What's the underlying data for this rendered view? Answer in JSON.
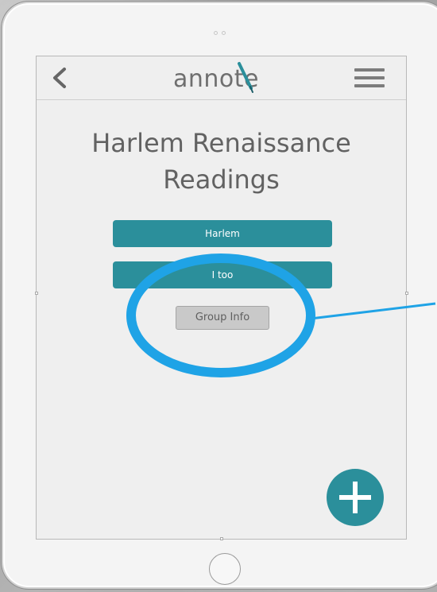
{
  "app": {
    "logo_text": "annote"
  },
  "page": {
    "title_line1": "Harlem Renaissance",
    "title_line2": "Readings"
  },
  "readings": [
    {
      "label": "Harlem"
    },
    {
      "label": "I too"
    }
  ],
  "actions": {
    "group_info_label": "Group Info"
  },
  "icons": {
    "back": "chevron-left-icon",
    "menu": "hamburger-menu-icon",
    "add": "plus-icon",
    "logo_mark": "pen-icon"
  },
  "colors": {
    "accent": "#2b8f9b",
    "annotation": "#1fa3e6",
    "title_text": "#626262",
    "neutral_button": "#c9c9c9"
  }
}
